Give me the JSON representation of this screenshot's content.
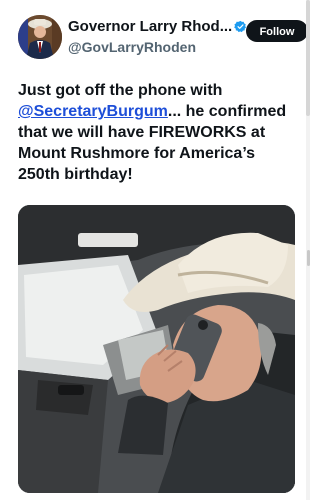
{
  "post": {
    "author": {
      "display_name": "Governor Larry Rhod...",
      "handle": "@GovLarryRhoden",
      "verified": true,
      "avatar_icon": "profile-photo"
    },
    "follow_label": "Follow",
    "text": {
      "line_prefix": "Just got off the phone with",
      "mention": "@SecretaryBurgum",
      "rest": "... he confirmed that we will have FIREWORKS at Mount Rushmore for America’s 250th birthday!"
    },
    "media": {
      "type": "photo",
      "icon": "photo-man-in-cowboy-hat-on-phone"
    }
  },
  "colors": {
    "link": "#1d4ed8",
    "verified_badge": "#1d9bf0",
    "follow_bg": "#0f1419",
    "handle": "#536471"
  }
}
